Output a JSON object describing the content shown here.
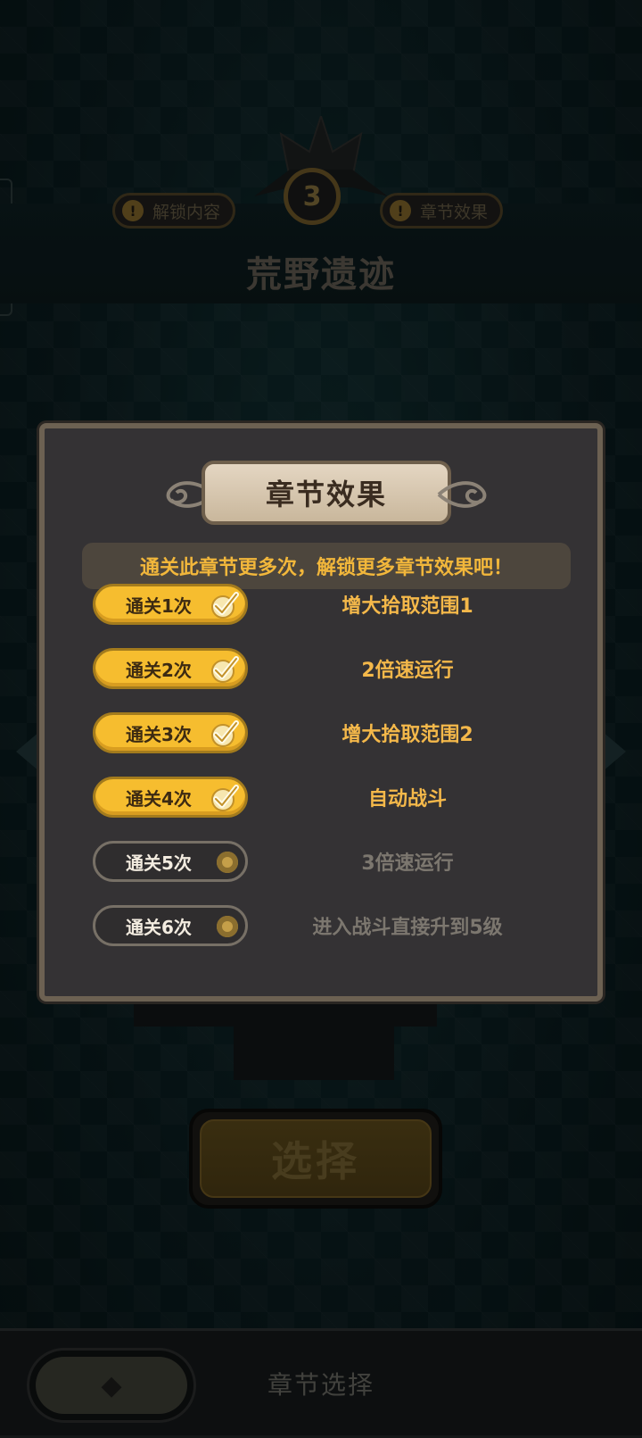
{
  "header": {
    "chapter_number": "3",
    "unlock_content_label": "解锁内容",
    "chapter_effect_label": "章节效果",
    "world_title": "荒野遗迹"
  },
  "modal": {
    "title": "章节效果",
    "notice": "通关此章节更多次，解锁更多章节效果吧！",
    "rows": [
      {
        "badge": "通关1次",
        "effect": "增大拾取范围1",
        "status": "unlocked"
      },
      {
        "badge": "通关2次",
        "effect": "2倍速运行",
        "status": "unlocked"
      },
      {
        "badge": "通关3次",
        "effect": "增大拾取范围2",
        "status": "unlocked"
      },
      {
        "badge": "通关4次",
        "effect": "自动战斗",
        "status": "unlocked"
      },
      {
        "badge": "通关5次",
        "effect": "3倍速运行",
        "status": "locked"
      },
      {
        "badge": "通关6次",
        "effect": "进入战斗直接升到5级",
        "status": "locked"
      }
    ]
  },
  "select_button_label": "选择",
  "bottom_nav": {
    "label": "章节选择"
  },
  "colors": {
    "gold": "#f6bd2f",
    "effect_unlocked": "#f4b84a",
    "effect_locked": "#7c776f"
  }
}
